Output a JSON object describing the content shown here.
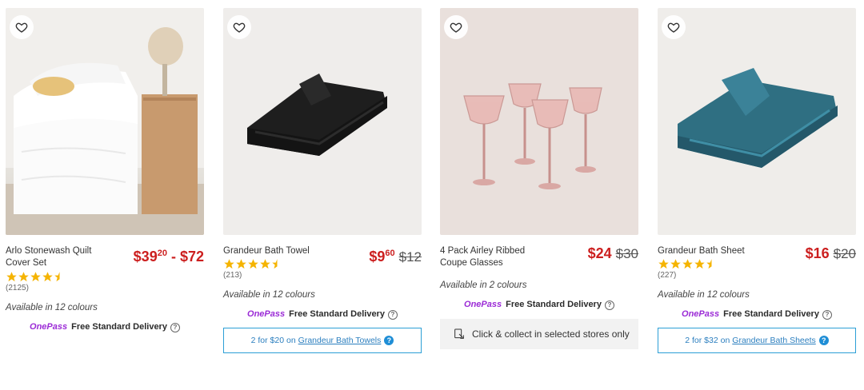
{
  "products": [
    {
      "name": "Arlo Stonewash Quilt Cover Set",
      "price_main": "$39",
      "price_sup": "20",
      "price_suffix": " - $72",
      "was_price": "",
      "rating_count": "(2125)",
      "availability": "Available in 12 colours",
      "onepass": "OnePass",
      "delivery": "Free Standard Delivery",
      "rating": 4.5
    },
    {
      "name": "Grandeur Bath Towel",
      "price_main": "$9",
      "price_sup": "60",
      "price_suffix": "",
      "was_price": "$12",
      "rating_count": "(213)",
      "availability": "Available in 12 colours",
      "onepass": "OnePass",
      "delivery": "Free Standard Delivery",
      "promo_text": "2 for $20 on",
      "promo_link": "Grandeur Bath Towels",
      "rating": 4.5
    },
    {
      "name": "4 Pack Airley Ribbed Coupe Glasses",
      "price_main": "$24",
      "price_sup": "",
      "price_suffix": "",
      "was_price": "$30",
      "availability": "Available in 2 colours",
      "onepass": "OnePass",
      "delivery": "Free Standard Delivery",
      "click_collect": "Click & collect in selected stores only"
    },
    {
      "name": "Grandeur Bath Sheet",
      "price_main": "$16",
      "price_sup": "",
      "price_suffix": "",
      "was_price": "$20",
      "rating_count": "(227)",
      "availability": "Available in 12 colours",
      "onepass": "OnePass",
      "delivery": "Free Standard Delivery",
      "promo_text": "2 for $32 on",
      "promo_link": "Grandeur Bath Sheets",
      "rating": 4.5
    }
  ],
  "icons": {
    "favourite": "heart-outline-icon",
    "help": "question-circle-icon",
    "info": "info-filled-icon",
    "click_collect": "click-collect-icon"
  },
  "colors": {
    "price": "#cc1f1f",
    "onepass": "#9b2bd6",
    "star": "#f5b400",
    "promo": "#2c9fd6"
  }
}
